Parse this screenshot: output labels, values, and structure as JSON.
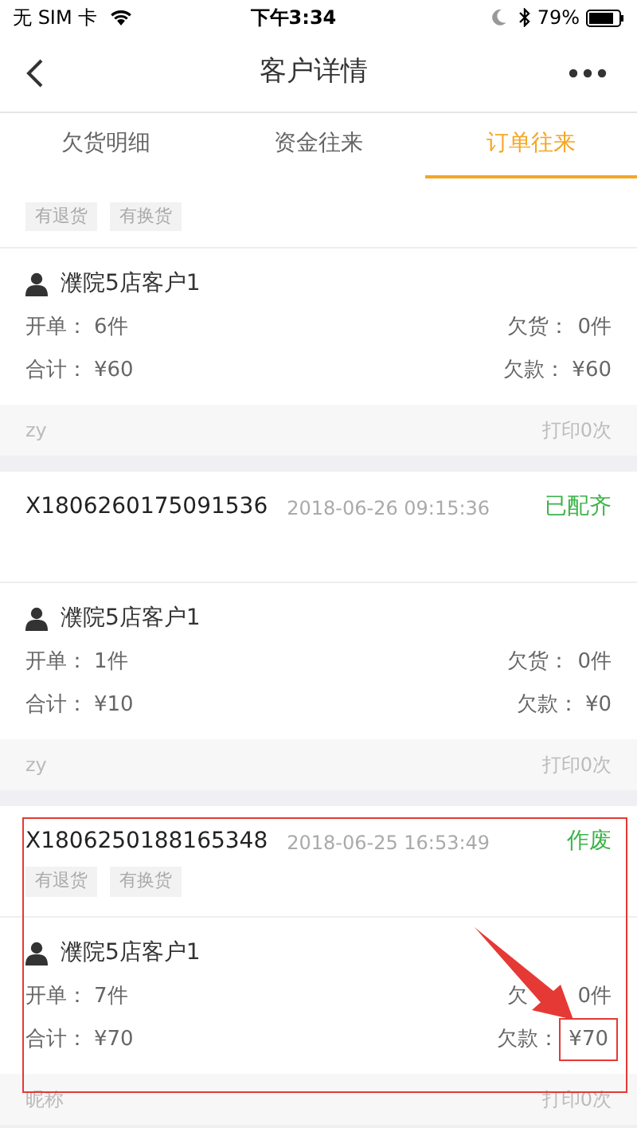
{
  "status_bar": {
    "carrier": "无 SIM 卡",
    "time": "下午3:34",
    "battery": "79%"
  },
  "nav": {
    "title": "客户详情"
  },
  "tabs": [
    {
      "label": "欠货明细",
      "selected": false
    },
    {
      "label": "资金往来",
      "selected": false
    },
    {
      "label": "订单往来",
      "selected": true
    }
  ],
  "orders": [
    {
      "tags": [
        "有退货",
        "有换货"
      ],
      "customer": "濮院5店客户1",
      "opened_label": "开单：",
      "opened": "6件",
      "owed_goods_label": "欠货：",
      "owed_goods": "0件",
      "total_label": "合计：",
      "total": "¥60",
      "owed_money_label": "欠款：",
      "owed_money": "¥60",
      "operator": "zy",
      "prints": "打印0次",
      "annotated": false
    },
    {
      "order_no": "X1806260175091536",
      "time": "2018-06-26 09:15:36",
      "status": "已配齐",
      "customer": "濮院5店客户1",
      "opened_label": "开单：",
      "opened": "1件",
      "owed_goods_label": "欠货：",
      "owed_goods": "0件",
      "total_label": "合计：",
      "total": "¥10",
      "owed_money_label": "欠款：",
      "owed_money": "¥0",
      "operator": "zy",
      "prints": "打印0次",
      "annotated": false
    },
    {
      "order_no": "X1806250188165348",
      "time": "2018-06-25 16:53:49",
      "status": "作废",
      "tags": [
        "有退货",
        "有换货"
      ],
      "customer": "濮院5店客户1",
      "opened_label": "开单：",
      "opened": "7件",
      "owed_goods_label": "欠",
      "owed_goods": "0件",
      "total_label": "合计：",
      "total": "¥70",
      "owed_money_label": "欠款：",
      "owed_money": "¥70",
      "operator": "昵称",
      "prints": "打印0次",
      "annotated": true
    }
  ]
}
